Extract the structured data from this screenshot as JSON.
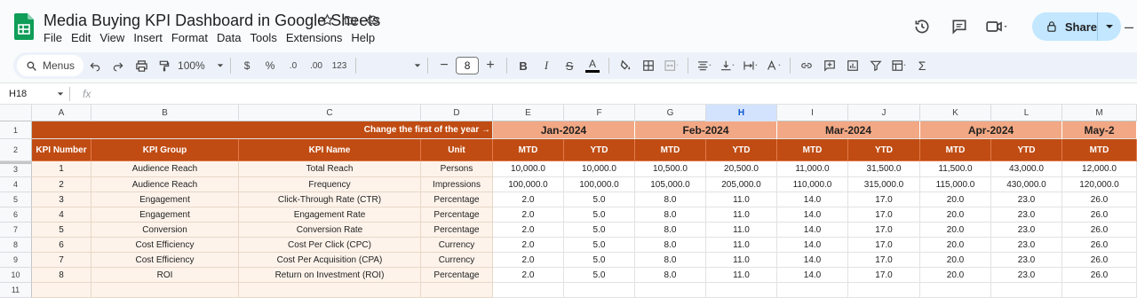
{
  "doc": {
    "title": "Media Buying KPI Dashboard in Google Sheets",
    "menus": [
      "File",
      "Edit",
      "View",
      "Insert",
      "Format",
      "Data",
      "Tools",
      "Extensions",
      "Help"
    ],
    "share_label": "Share"
  },
  "toolbar": {
    "menus_label": "Menus",
    "zoom": "100%",
    "currency": "$",
    "percent": "%",
    "dec_decrease": ".0",
    "dec_increase": ".00",
    "number_format": "123",
    "font_size": "8"
  },
  "formula_bar": {
    "name_box": "H18",
    "fx": "fx"
  },
  "sheet": {
    "selected_column": "H",
    "columns": [
      "A",
      "B",
      "C",
      "D",
      "E",
      "F",
      "G",
      "H",
      "I",
      "J",
      "K",
      "L",
      "M"
    ],
    "rows": [
      "1",
      "2",
      "3",
      "4",
      "5",
      "6",
      "7",
      "8",
      "9",
      "10",
      "11"
    ],
    "note": "Change the first of the year →",
    "months": [
      "Jan-2024",
      "Feb-2024",
      "Mar-2024",
      "Apr-2024",
      "May-2"
    ],
    "headers": [
      "KPI Number",
      "KPI Group",
      "KPI Name",
      "Unit"
    ],
    "mtd": "MTD",
    "ytd": "YTD",
    "kpis": [
      {
        "num": "1",
        "group": "Audience Reach",
        "name": "Total Reach",
        "unit": "Persons",
        "vals": [
          "10,000.0",
          "10,000.0",
          "10,500.0",
          "20,500.0",
          "11,000.0",
          "31,500.0",
          "11,500.0",
          "43,000.0",
          "12,000.0"
        ]
      },
      {
        "num": "2",
        "group": "Audience Reach",
        "name": "Frequency",
        "unit": "Impressions",
        "vals": [
          "100,000.0",
          "100,000.0",
          "105,000.0",
          "205,000.0",
          "110,000.0",
          "315,000.0",
          "115,000.0",
          "430,000.0",
          "120,000.0"
        ]
      },
      {
        "num": "3",
        "group": "Engagement",
        "name": "Click-Through Rate (CTR)",
        "unit": "Percentage",
        "vals": [
          "2.0",
          "5.0",
          "8.0",
          "11.0",
          "14.0",
          "17.0",
          "20.0",
          "23.0",
          "26.0"
        ]
      },
      {
        "num": "4",
        "group": "Engagement",
        "name": "Engagement Rate",
        "unit": "Percentage",
        "vals": [
          "2.0",
          "5.0",
          "8.0",
          "11.0",
          "14.0",
          "17.0",
          "20.0",
          "23.0",
          "26.0"
        ]
      },
      {
        "num": "5",
        "group": "Conversion",
        "name": "Conversion Rate",
        "unit": "Percentage",
        "vals": [
          "2.0",
          "5.0",
          "8.0",
          "11.0",
          "14.0",
          "17.0",
          "20.0",
          "23.0",
          "26.0"
        ]
      },
      {
        "num": "6",
        "group": "Cost Efficiency",
        "name": "Cost Per Click (CPC)",
        "unit": "Currency",
        "vals": [
          "2.0",
          "5.0",
          "8.0",
          "11.0",
          "14.0",
          "17.0",
          "20.0",
          "23.0",
          "26.0"
        ]
      },
      {
        "num": "7",
        "group": "Cost Efficiency",
        "name": "Cost Per Acquisition (CPA)",
        "unit": "Currency",
        "vals": [
          "2.0",
          "5.0",
          "8.0",
          "11.0",
          "14.0",
          "17.0",
          "20.0",
          "23.0",
          "26.0"
        ]
      },
      {
        "num": "8",
        "group": "ROI",
        "name": "Return on Investment (ROI)",
        "unit": "Percentage",
        "vals": [
          "2.0",
          "5.0",
          "8.0",
          "11.0",
          "14.0",
          "17.0",
          "20.0",
          "23.0",
          "26.0"
        ]
      }
    ]
  },
  "colors": {
    "header_dark": "#c04c13",
    "header_light": "#f2a884",
    "info_fill": "#fdf3ea",
    "share_bg": "#c2e7ff",
    "selection": "#d3e3fd"
  }
}
